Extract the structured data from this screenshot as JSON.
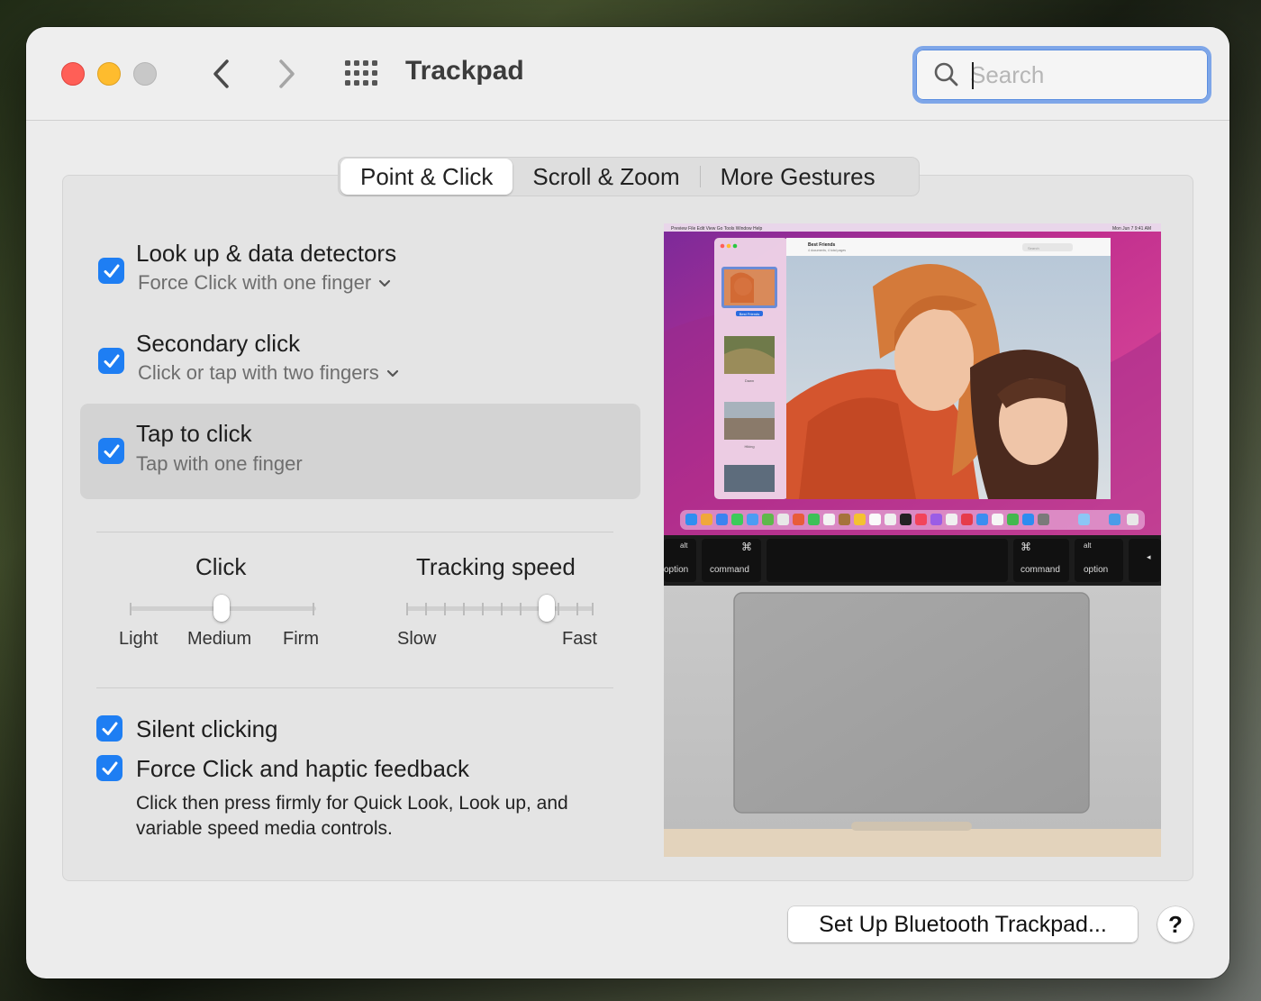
{
  "window": {
    "title": "Trackpad"
  },
  "search": {
    "placeholder": "Search",
    "value": ""
  },
  "tabs": [
    {
      "label": "Point & Click",
      "active": true
    },
    {
      "label": "Scroll & Zoom",
      "active": false
    },
    {
      "label": "More Gestures",
      "active": false
    }
  ],
  "options": [
    {
      "title": "Look up & data detectors",
      "subtitle": "Force Click with one finger",
      "checked": true,
      "has_dropdown": true
    },
    {
      "title": "Secondary click",
      "subtitle": "Click or tap with two fingers",
      "checked": true,
      "has_dropdown": true
    },
    {
      "title": "Tap to click",
      "subtitle": "Tap with one finger",
      "checked": true,
      "has_dropdown": false,
      "highlighted": true
    }
  ],
  "click_slider": {
    "title": "Click",
    "labels": [
      "Light",
      "Medium",
      "Firm"
    ],
    "selected": "Medium"
  },
  "tracking_slider": {
    "title": "Tracking speed",
    "min_label": "Slow",
    "max_label": "Fast",
    "steps": 10,
    "value_step": 8
  },
  "bottom_options": [
    {
      "title": "Silent clicking",
      "checked": true
    },
    {
      "title": "Force Click and haptic feedback",
      "checked": true
    }
  ],
  "force_click_description": "Click then press firmly for Quick Look, Look up, and variable speed media controls.",
  "preview": {
    "menu_items": [
      "Preview",
      "File",
      "Edit",
      "View",
      "Go",
      "Tools",
      "Window",
      "Help"
    ],
    "menubar_clock": "Mon Jun 7  9:41 AM",
    "doc_title": "Best Friends",
    "doc_subtitle": "4 documents, 4 total pages",
    "doc_search": "Search",
    "thumb_labels": [
      "Best Friends",
      "Dawn",
      "Hiking",
      ""
    ],
    "keys": [
      {
        "top": "alt",
        "bottom": "option"
      },
      {
        "top": "⌘",
        "bottom": "command"
      },
      {
        "top": "⌘",
        "bottom": "command"
      },
      {
        "top": "alt",
        "bottom": "option"
      },
      {
        "top": "◂",
        "bottom": ""
      }
    ]
  },
  "buttons": {
    "setup_bluetooth": "Set Up Bluetooth Trackpad...",
    "help": "?"
  },
  "colors": {
    "accent": "#1e7ef3",
    "search_focus": "#7ea6e8"
  }
}
